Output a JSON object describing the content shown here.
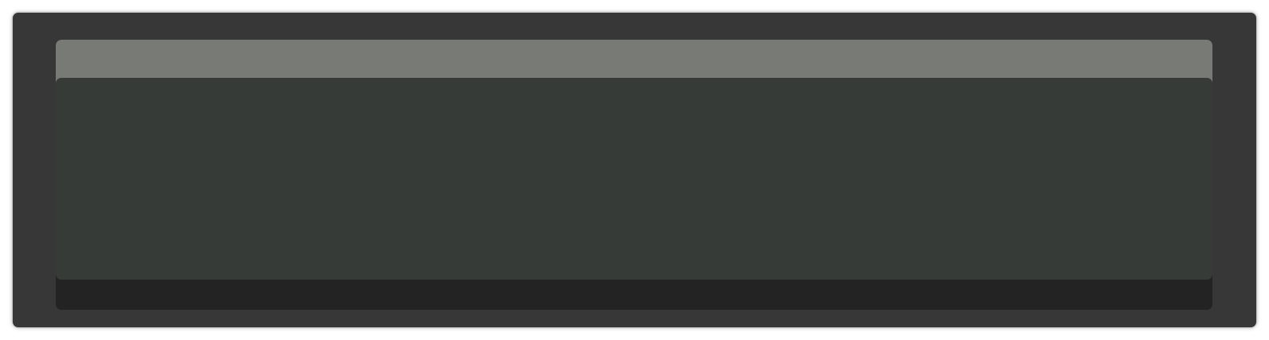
{
  "colors": {
    "window_background": "#373737",
    "panel_header": "#787a76",
    "panel_body": "#363b37",
    "panel_footer": "#232323",
    "page_background": "#ffffff"
  }
}
